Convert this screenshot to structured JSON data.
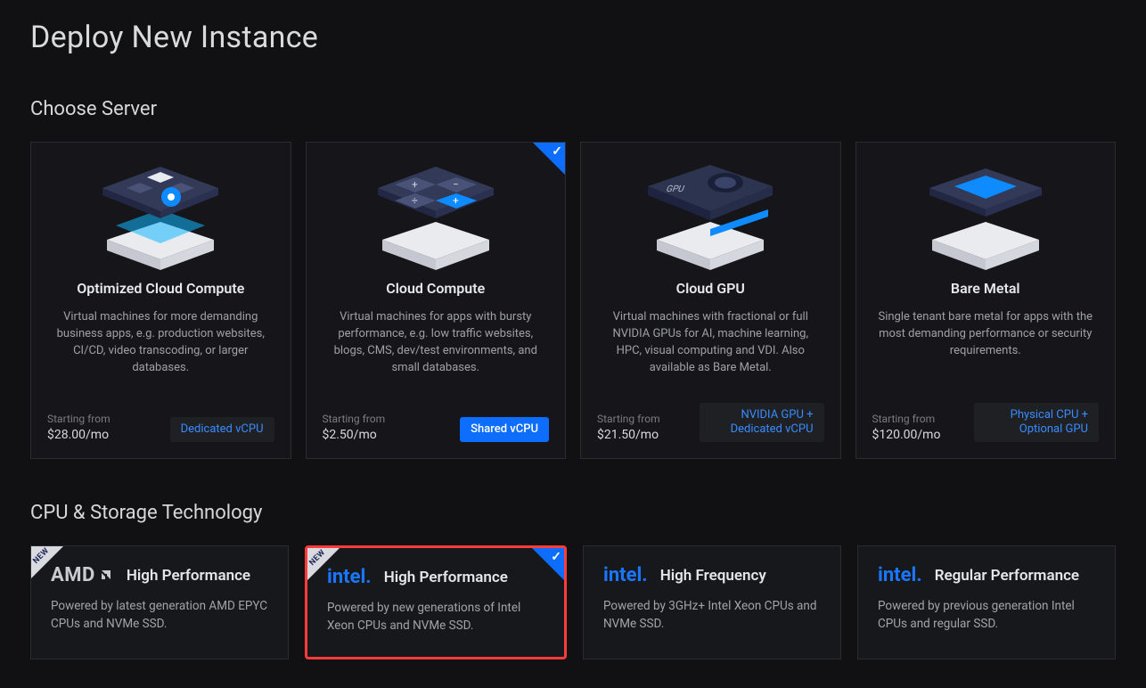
{
  "page": {
    "title": "Deploy New Instance"
  },
  "sections": {
    "servers_heading": "Choose Server",
    "tech_heading": "CPU & Storage Technology"
  },
  "server_cards": [
    {
      "title": "Optimized Cloud Compute",
      "desc": "Virtual machines for more demanding business apps, e.g. production websites, CI/CD, video transcoding, or larger databases.",
      "starting_label": "Starting from",
      "price": "$28.00/mo",
      "badge": "Dedicated vCPU",
      "badge_style": "dark",
      "selected": false
    },
    {
      "title": "Cloud Compute",
      "desc": "Virtual machines for apps with bursty performance, e.g. low traffic websites, blogs, CMS, dev/test environments, and small databases.",
      "starting_label": "Starting from",
      "price": "$2.50/mo",
      "badge": "Shared vCPU",
      "badge_style": "blue-solid",
      "selected": true
    },
    {
      "title": "Cloud GPU",
      "desc": "Virtual machines with fractional or full NVIDIA GPUs for AI, machine learning, HPC, visual computing and VDI. Also available as Bare Metal.",
      "starting_label": "Starting from",
      "price": "$21.50/mo",
      "badge": "NVIDIA GPU + Dedicated vCPU",
      "badge_style": "dark",
      "selected": false
    },
    {
      "title": "Bare Metal",
      "desc": "Single tenant bare metal for apps with the most demanding performance or security requirements.",
      "starting_label": "Starting from",
      "price": "$120.00/mo",
      "badge": "Physical CPU + Optional GPU",
      "badge_style": "dark2",
      "selected": false
    }
  ],
  "tech_cards": [
    {
      "vendor": "AMD",
      "vendor_class": "amd",
      "title": "High Performance",
      "desc": "Powered by latest generation AMD EPYC CPUs and NVMe SSD.",
      "new": true,
      "selected": false,
      "highlighted": false
    },
    {
      "vendor": "intel.",
      "vendor_class": "intel",
      "title": "High Performance",
      "desc": "Powered by new generations of Intel Xeon CPUs and NVMe SSD.",
      "new": true,
      "selected": true,
      "highlighted": true
    },
    {
      "vendor": "intel.",
      "vendor_class": "intel",
      "title": "High Frequency",
      "desc": "Powered by 3GHz+ Intel Xeon CPUs and NVMe SSD.",
      "new": false,
      "selected": false,
      "highlighted": false
    },
    {
      "vendor": "intel.",
      "vendor_class": "intel",
      "title": "Regular Performance",
      "desc": "Powered by previous generation Intel CPUs and regular SSD.",
      "new": false,
      "selected": false,
      "highlighted": false
    }
  ]
}
